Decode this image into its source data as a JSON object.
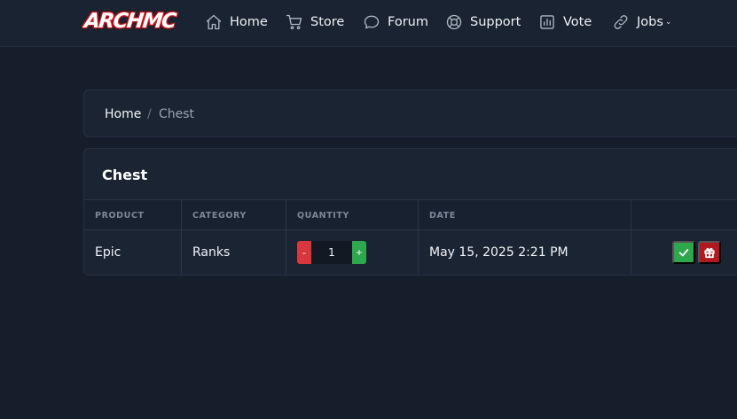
{
  "brand": {
    "logo_text": "ARCHMC"
  },
  "nav": {
    "items": [
      {
        "label": "Home",
        "icon": "home-icon"
      },
      {
        "label": "Store",
        "icon": "cart-icon"
      },
      {
        "label": "Forum",
        "icon": "chat-icon"
      },
      {
        "label": "Support",
        "icon": "lifebuoy-icon"
      },
      {
        "label": "Vote",
        "icon": "chart-icon"
      },
      {
        "label": "Jobs",
        "icon": "link-icon",
        "has_dropdown": true
      }
    ]
  },
  "breadcrumb": {
    "home": "Home",
    "separator": "/",
    "current": "Chest"
  },
  "chest": {
    "title": "Chest",
    "columns": [
      "PRODUCT",
      "CATEGORY",
      "QUANTITY",
      "DATE",
      ""
    ],
    "rows": [
      {
        "product": "Epic",
        "category": "Ranks",
        "quantity": "1",
        "minus_label": "-",
        "plus_label": "+",
        "date": "May 15, 2025 2:21 PM",
        "actions": [
          "check-icon",
          "gift-icon"
        ]
      }
    ]
  },
  "colors": {
    "background": "#161e2b",
    "card": "#1b2433",
    "success": "#2ea84c",
    "danger": "#d9373d",
    "gift": "#b3181f",
    "logo_outline": "#d0181e"
  }
}
